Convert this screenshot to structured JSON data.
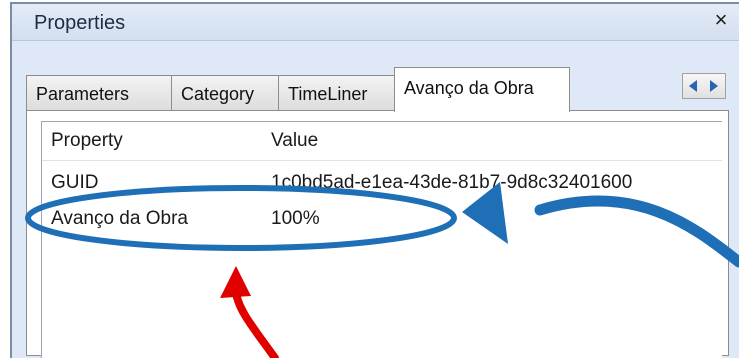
{
  "panel": {
    "title": "Properties",
    "close_glyph": "×"
  },
  "tabs": [
    {
      "label": "Parameters"
    },
    {
      "label": "Category"
    },
    {
      "label": "TimeLiner"
    },
    {
      "label": "Avanço da Obra",
      "active": true
    }
  ],
  "grid": {
    "columns": [
      "Property",
      "Value"
    ],
    "rows": [
      {
        "property": "GUID",
        "value": "1c0bd5ad-e1ea-43de-81b7-9d8c32401600"
      },
      {
        "property": "Avanço da Obra",
        "value": "100%"
      }
    ]
  },
  "annotations": {
    "ellipse_color": "#1f6fb7",
    "blue_arrow_color": "#1f6fb7",
    "red_arrow_color": "#e00000"
  }
}
